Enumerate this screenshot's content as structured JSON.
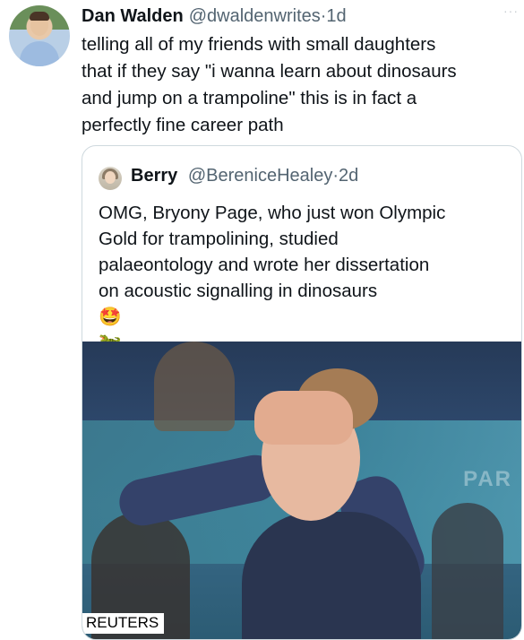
{
  "tweet": {
    "author_name": "Dan Walden",
    "author_handle": "@dwaldenwrites",
    "separator": "·",
    "time": "1d",
    "more": "···",
    "text_lines": [
      "telling all of my friends with small daughters",
      "that if they say \"i wanna learn about dinosaurs",
      "and jump on a trampoline\" this is in fact a",
      "perfectly fine career path"
    ]
  },
  "quote": {
    "author_name": "Berry",
    "author_handle": "@BereniceHealey",
    "separator": "·",
    "time": "2d",
    "text_lines": [
      "OMG, Bryony Page, who just won Olympic",
      "Gold for trampolining, studied",
      "palaeontology and wrote her dissertation",
      "on acoustic signalling in dinosaurs"
    ],
    "emojis": [
      "🤩",
      "🦖",
      "🦕"
    ],
    "photo": {
      "credit": "REUTERS",
      "background_text": "PAR"
    }
  }
}
